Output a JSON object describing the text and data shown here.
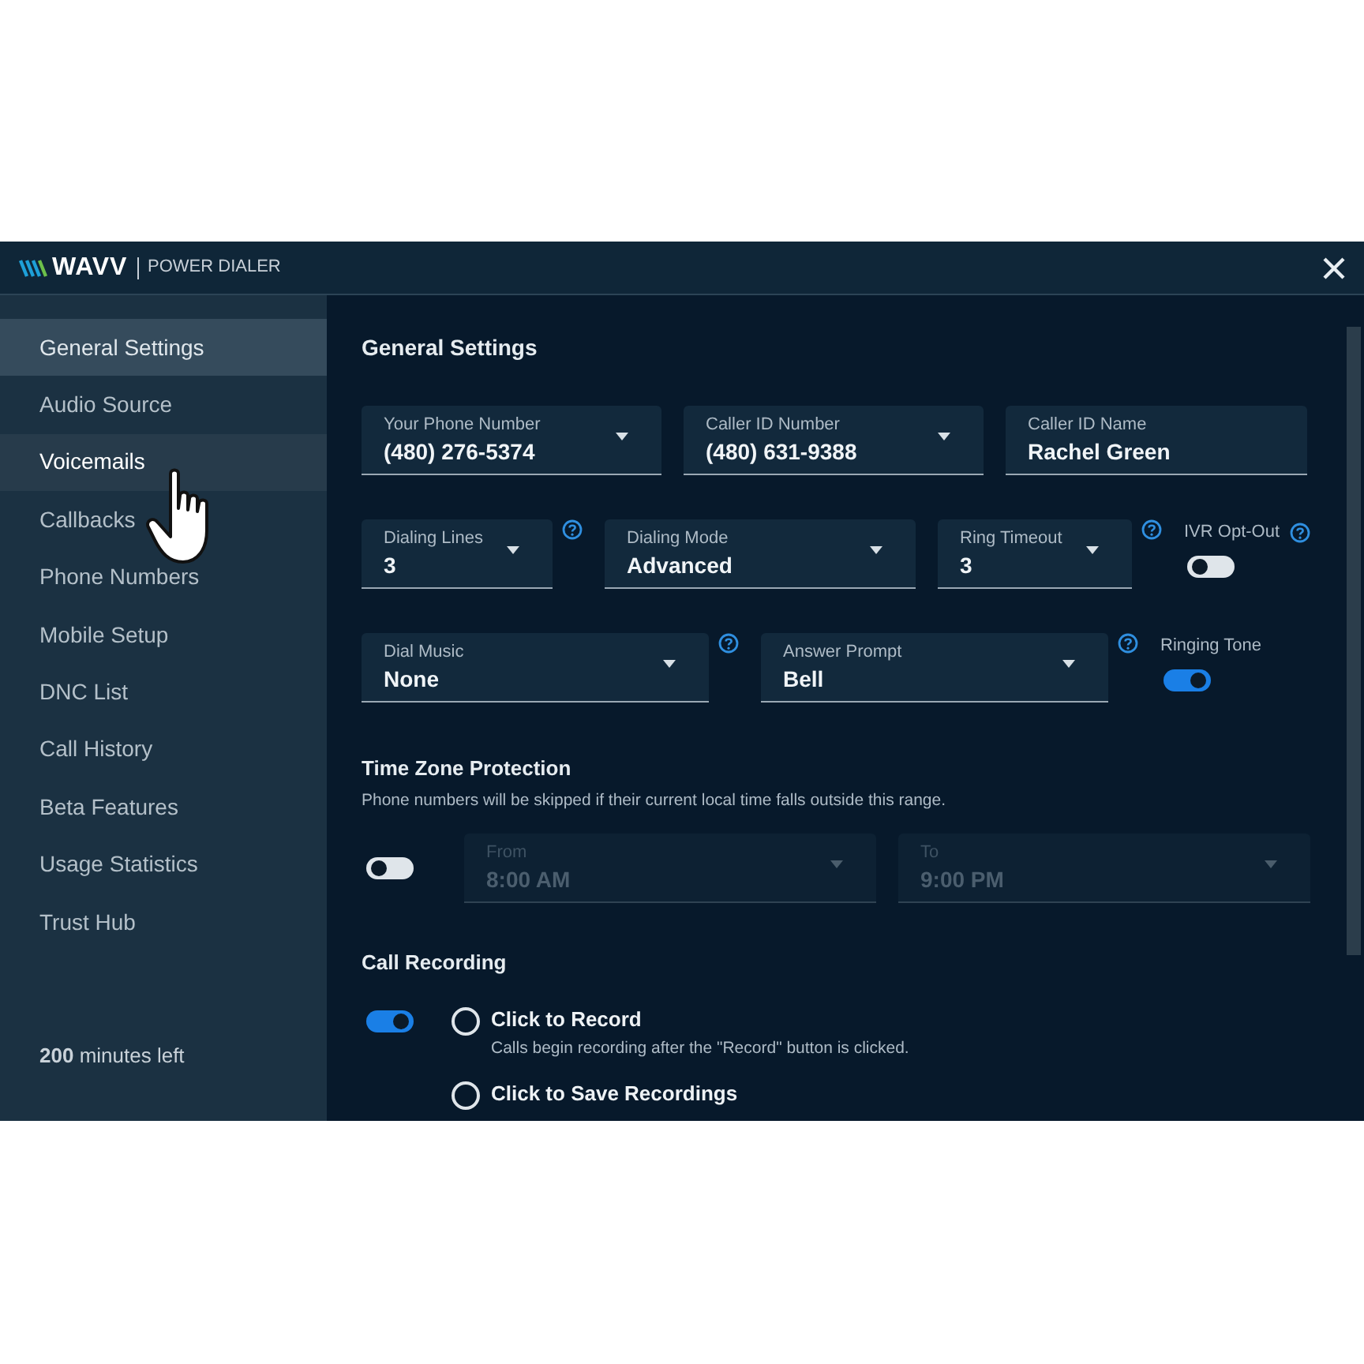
{
  "header": {
    "logo": "WAVV",
    "product": "POWER DIALER"
  },
  "sidebar": {
    "items": [
      {
        "label": "General Settings",
        "selected": true,
        "hovered": false
      },
      {
        "label": "Audio Source",
        "selected": false,
        "hovered": false
      },
      {
        "label": "Voicemails",
        "selected": false,
        "hovered": true
      },
      {
        "label": "Callbacks",
        "selected": false,
        "hovered": false
      },
      {
        "label": "Phone Numbers",
        "selected": false,
        "hovered": false
      },
      {
        "label": "Mobile Setup",
        "selected": false,
        "hovered": false
      },
      {
        "label": "DNC List",
        "selected": false,
        "hovered": false
      },
      {
        "label": "Call History",
        "selected": false,
        "hovered": false
      },
      {
        "label": "Beta Features",
        "selected": false,
        "hovered": false
      },
      {
        "label": "Usage Statistics",
        "selected": false,
        "hovered": false
      },
      {
        "label": "Trust Hub",
        "selected": false,
        "hovered": false
      }
    ],
    "minutes_left": "**200** minutes left"
  },
  "main": {
    "title": "General Settings",
    "rows": [
      {
        "fields": [
          {
            "kind": "select",
            "label": "Your Phone Number",
            "value": "(480) 276-5374",
            "help": false
          },
          {
            "kind": "select",
            "label": "Caller ID Number",
            "value": "(480) 631-9388",
            "help": false
          },
          {
            "kind": "text",
            "label": "Caller ID Name",
            "value": "Rachel Green",
            "help": false
          }
        ]
      },
      {
        "fields": [
          {
            "kind": "select",
            "label": "Dialing Lines",
            "value": "3",
            "help": true
          },
          {
            "kind": "select",
            "label": "Dialing Mode",
            "value": "Advanced",
            "help": false
          },
          {
            "kind": "select",
            "label": "Ring Timeout",
            "value": "3",
            "help": true
          },
          {
            "kind": "toggle",
            "label": "IVR Opt-Out",
            "on": false,
            "help": true
          }
        ]
      },
      {
        "fields": [
          {
            "kind": "select",
            "label": "Dial Music",
            "value": "None",
            "help": true
          },
          {
            "kind": "select",
            "label": "Answer Prompt",
            "value": "Bell",
            "help": true
          },
          {
            "kind": "toggle",
            "label": "Ringing Tone",
            "on": true,
            "help": false
          }
        ]
      }
    ],
    "time_zone": {
      "title": "Time Zone Protection",
      "description": "Phone numbers will be skipped if their current local time falls outside this range.",
      "on": false,
      "fields": [
        {
          "label": "From",
          "value": "8:00 AM",
          "disabled": true
        },
        {
          "label": "To",
          "value": "9:00 PM",
          "disabled": true
        }
      ]
    },
    "call_recording": {
      "title": "Call Recording",
      "on": true,
      "options": [
        {
          "label": "Click to Record",
          "description": "Calls begin recording after the \"Record\" button is clicked.",
          "selected": false
        },
        {
          "label": "Click to Save Recordings",
          "selected": false
        }
      ]
    }
  }
}
